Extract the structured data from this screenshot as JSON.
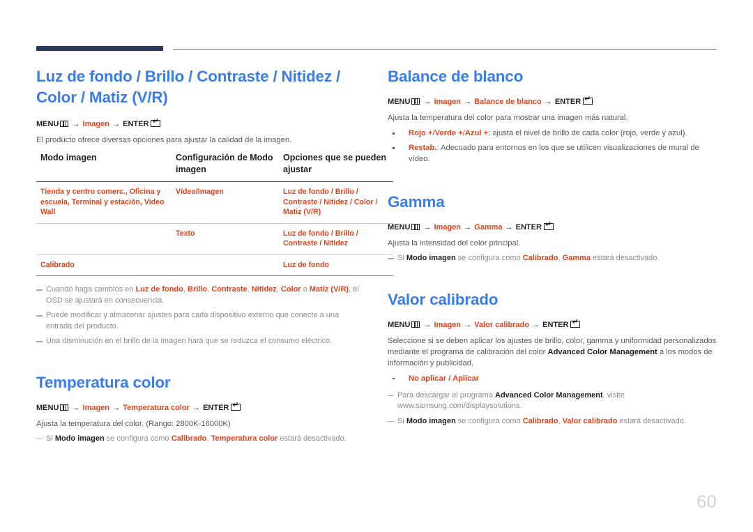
{
  "page": {
    "number": "60",
    "accent_blue": "#3b7de9",
    "accent_red": "#e0431c",
    "rule_navy": "#2b3a5c",
    "body_gray": "#58585b"
  },
  "menu_labels": {
    "menu": "MENU",
    "enter": "ENTER",
    "arrow": "→",
    "imagen": "Imagen"
  },
  "left": {
    "section1": {
      "heading": "Luz de fondo / Brillo / Contraste / Nitidez / Color / Matiz (V/R)",
      "path": [
        "MENU",
        "Imagen",
        "ENTER"
      ],
      "intro": "El producto ofrece diversas opciones para ajustar la calidad de la imagen.",
      "table": {
        "headers": [
          "Modo imagen",
          "Configuración de Modo imagen",
          "Opciones que se pueden ajustar"
        ],
        "rows": [
          {
            "mode": "Tienda y centro comerc., Oficina y escuela, Terminal y estación, Video Wall",
            "config": "Vídeo/Imagen",
            "options": "Luz de fondo /  Brillo / Contraste / Nitidez / Color / Matiz (V/R)"
          },
          {
            "mode": "",
            "config": "Texto",
            "options": "Luz de fondo / Brillo / Contraste / Nitidez"
          },
          {
            "mode": "Calibrado",
            "config": "",
            "options": "Luz de fondo"
          }
        ]
      },
      "notes": [
        "Cuando haga cambios en Luz de fondo, Brillo, Contraste, Nitidez, Color o Matiz (V/R), el OSD se ajustará en consecuencia.",
        "Puede modificar y almacenar ajustes para cada dispositivo externo que conecte a una entrada del producto.",
        "Una disminución en el brillo de la imagen hará que se reduzca el consumo eléctrico."
      ]
    },
    "section2": {
      "heading": "Temperatura color",
      "path": [
        "MENU",
        "Imagen",
        "Temperatura color",
        "ENTER"
      ],
      "intro": "Ajusta la temperatura del color. (Rango: 2800K-16000K)",
      "note": "Si Modo imagen se configura como Calibrado, Temperatura color estará desactivado."
    }
  },
  "right": {
    "section1": {
      "heading": "Balance de blanco",
      "path": [
        "MENU",
        "Imagen",
        "Balance de blanco",
        "ENTER"
      ],
      "intro": "Ajusta la temperatura del color para mostrar una imagen más natural.",
      "bullets": [
        "Rojo +/Verde +/Azul +: ajusta el nivel de brillo de cada color (rojo, verde y azul).",
        "Restab.: Adecuado para entornos en los que se utilicen visualizaciones de mural de vídeo."
      ]
    },
    "section2": {
      "heading": "Gamma",
      "path": [
        "MENU",
        "Imagen",
        "Gamma",
        "ENTER"
      ],
      "intro": "Ajusta la intensidad del color principal.",
      "note": "Si Modo imagen se configura como Calibrado, Gamma estará desactivado."
    },
    "section3": {
      "heading": "Valor calibrado",
      "path": [
        "MENU",
        "Imagen",
        "Valor calibrado",
        "ENTER"
      ],
      "intro": "Seleccione si se deben aplicar los ajustes de brillo, color, gamma y uniformidad personalizados mediante el programa de calibración del color Advanced Color Management a los modos de información y publicidad.",
      "bullets": [
        "No aplicar / Aplicar"
      ],
      "notes": [
        "Para descargar el programa Advanced Color Management, visite www.samsung.com/displaysolutions.",
        "Si Modo imagen se configura como Calibrado, Valor calibrado estará desactivado."
      ]
    }
  }
}
